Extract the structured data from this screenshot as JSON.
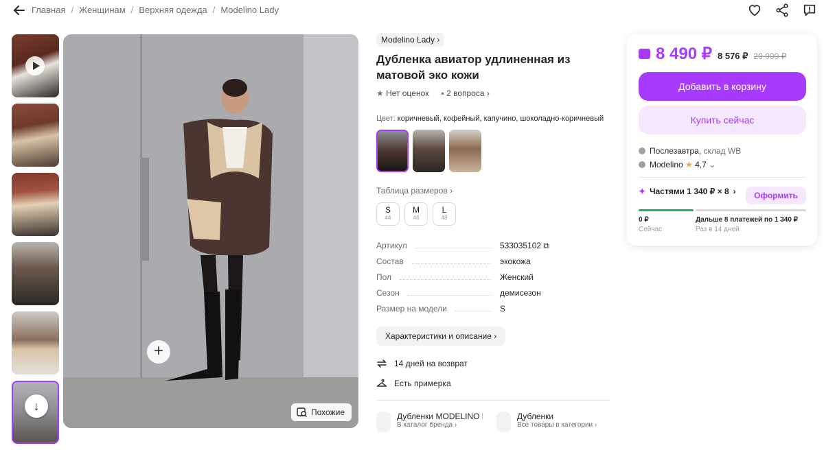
{
  "breadcrumbs": [
    "Главная",
    "Женщинам",
    "Верхняя одежда",
    "Modelino Lady"
  ],
  "header_icons": [
    "back-arrow-icon",
    "heart-icon",
    "share-icon",
    "feedback-icon"
  ],
  "gallery": {
    "thumbnail_count": 6,
    "similar_label": "Похожие"
  },
  "product": {
    "brand": "Modelino Lady",
    "title": "Дубленка авиатор удлиненная из матовой эко кожи",
    "rating": "Нет оценок",
    "questions": "2 вопроса",
    "color_label": "Цвет:",
    "color_value": "коричневый, кофейный, капучино, шоколадно-коричневый",
    "size_table_label": "Таблица размеров",
    "sizes": [
      {
        "size": "S",
        "ru": "44"
      },
      {
        "size": "M",
        "ru": "46"
      },
      {
        "size": "L",
        "ru": "48"
      }
    ],
    "specs": [
      {
        "key": "Артикул",
        "value": "533035102"
      },
      {
        "key": "Состав",
        "value": "экокожа"
      },
      {
        "key": "Пол",
        "value": "Женский"
      },
      {
        "key": "Сезон",
        "value": "демисезон"
      },
      {
        "key": "Размер на модели",
        "value": "S"
      }
    ],
    "characteristics_button": "Характеристики и описание",
    "features": [
      "14 дней на возврат",
      "Есть примерка"
    ]
  },
  "categories": [
    {
      "title": "Дубленки MODELINO LADY",
      "subtitle": "В каталог бренда"
    },
    {
      "title": "Дубленки",
      "subtitle": "Все товары в категории"
    }
  ],
  "buy_card": {
    "price": "8 490 ₽",
    "price_card": "8 576 ₽",
    "price_old": "20 000 ₽",
    "add_to_cart": "Добавить в корзину",
    "buy_now": "Купить сейчас",
    "delivery": "Послезавтра,",
    "warehouse": "склад WB",
    "seller": "Modelino",
    "seller_rating": "4,7",
    "installments": "Частями 1 340 ₽ × 8",
    "installments_button": "Оформить",
    "pay_now_amount": "0 ₽",
    "pay_now_label": "Сейчас",
    "pay_later": "Дальше 8 платежей по 1 340 ₽",
    "pay_later_sub": "Раз в 14 дней",
    "installment_progress": 0.33
  },
  "colors": {
    "accent": "#a73afd",
    "accent_light": "#f5e8fe",
    "green": "#22b35e"
  }
}
